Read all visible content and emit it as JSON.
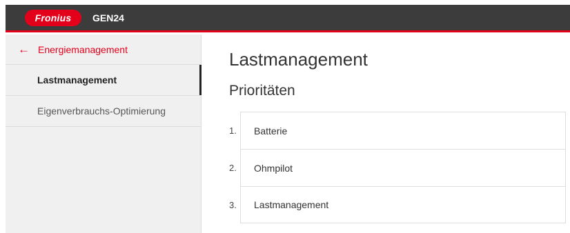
{
  "header": {
    "logo_text": "Fronius",
    "product": "GEN24",
    "brand_color": "#e3001b",
    "bar_color": "#3c3c3c"
  },
  "sidebar": {
    "back_label": "Energiemanagement",
    "back_icon": "arrow-left-icon",
    "items": [
      {
        "label": "Lastmanagement",
        "active": true
      },
      {
        "label": "Eigenverbrauchs-Optimierung",
        "active": false
      }
    ]
  },
  "main": {
    "title": "Lastmanagement",
    "section": "Prioritäten",
    "priorities": [
      {
        "num": "1.",
        "label": "Batterie"
      },
      {
        "num": "2.",
        "label": "Ohmpilot"
      },
      {
        "num": "3.",
        "label": "Lastmanagement"
      }
    ]
  }
}
